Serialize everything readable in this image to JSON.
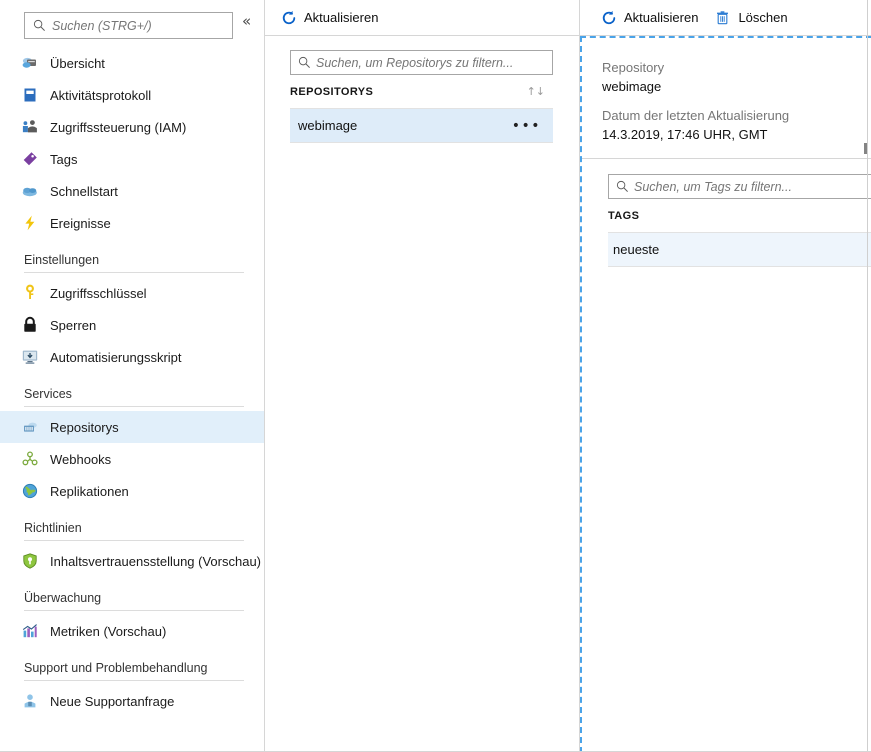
{
  "sidebar": {
    "search": {
      "placeholder": "Suchen (STRG+/)",
      "value": ""
    },
    "collapse_label": "«",
    "items": [
      {
        "label": "Übersicht",
        "icon": "overview-icon"
      },
      {
        "label": "Aktivitätsprotokoll",
        "icon": "activity-log-icon"
      },
      {
        "label": "Zugriffssteuerung (IAM)",
        "icon": "access-control-icon"
      },
      {
        "label": "Tags",
        "icon": "tag-icon"
      },
      {
        "label": "Schnellstart",
        "icon": "quickstart-icon"
      },
      {
        "label": "Ereignisse",
        "icon": "events-icon"
      }
    ],
    "groups": [
      {
        "title": "Einstellungen",
        "items": [
          {
            "label": "Zugriffsschlüssel",
            "icon": "key-icon"
          },
          {
            "label": "Sperren",
            "icon": "lock-icon"
          },
          {
            "label": "Automatisierungsskript",
            "icon": "automation-script-icon"
          }
        ]
      },
      {
        "title": "Services",
        "items": [
          {
            "label": "Repositorys",
            "icon": "repository-icon",
            "selected": true
          },
          {
            "label": "Webhooks",
            "icon": "webhook-icon"
          },
          {
            "label": "Replikationen",
            "icon": "replication-icon"
          }
        ]
      },
      {
        "title": "Richtlinien",
        "items": [
          {
            "label": "Inhaltsvertrauensstellung (Vorschau)",
            "icon": "content-trust-icon"
          }
        ]
      },
      {
        "title": "Überwachung",
        "items": [
          {
            "label": "Metriken (Vorschau)",
            "icon": "metrics-icon"
          }
        ]
      },
      {
        "title": "Support und Problembehandlung",
        "items": [
          {
            "label": "Neue Supportanfrage",
            "icon": "support-request-icon"
          }
        ]
      }
    ]
  },
  "repositories_pane": {
    "toolbar": {
      "refresh_label": "Aktualisieren",
      "refresh_icon": "refresh-icon"
    },
    "filter": {
      "placeholder": "Suchen, um Repositorys zu filtern...",
      "value": ""
    },
    "column_header": "REPOSITORYS",
    "sort_icon": "↑↓",
    "rows": [
      {
        "name": "webimage",
        "selected": true,
        "more_icon": "•••"
      }
    ]
  },
  "detail_pane": {
    "toolbar": {
      "refresh_label": "Aktualisieren",
      "refresh_icon": "refresh-icon",
      "delete_label": "Löschen",
      "delete_icon": "trash-icon"
    },
    "fields": [
      {
        "label": "Repository",
        "value": "webimage"
      },
      {
        "label": "Datum der letzten Aktualisierung",
        "value": "14.3.2019, 17:46 UHR, GMT"
      }
    ],
    "tags": {
      "filter": {
        "placeholder": "Suchen, um Tags zu filtern...",
        "value": ""
      },
      "column_header": "TAGS",
      "rows": [
        {
          "name": "neueste",
          "selected": true
        }
      ]
    }
  },
  "colors": {
    "accent": "#0078d4",
    "selection": "#deecf9",
    "nav_selection": "#e1effa",
    "dashed_border": "#4aa3e8",
    "border": "#d6d6d6"
  }
}
